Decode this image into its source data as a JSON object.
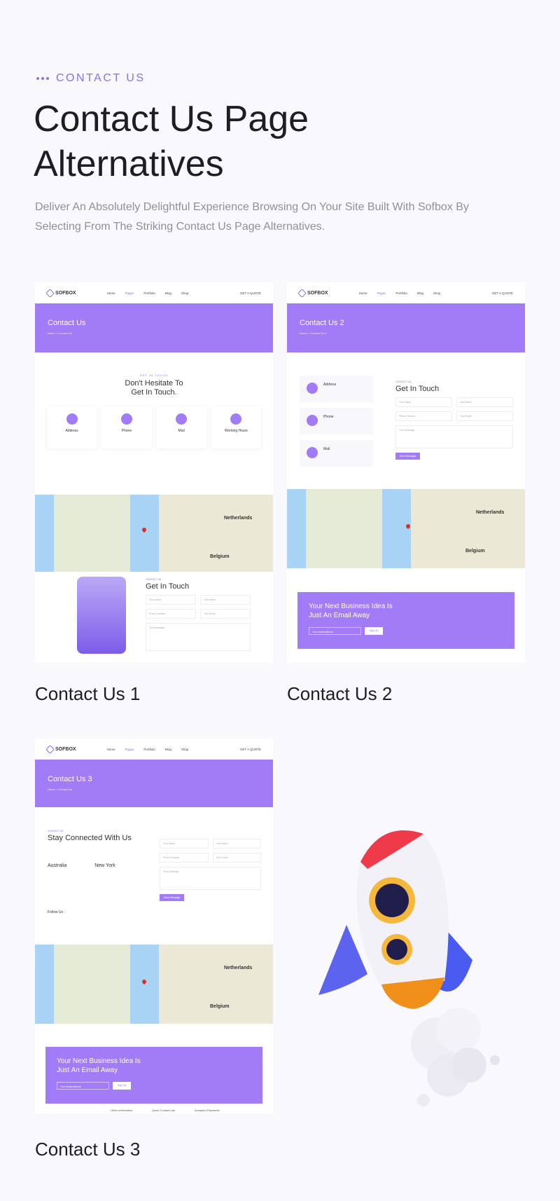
{
  "header": {
    "eyebrow": "CONTACT US",
    "title": "Contact Us Page Alternatives",
    "subtitle": "Deliver An Absolutely Delightful Experience Browsing On Your Site Built With Sofbox By Selecting From The Striking Contact Us Page Alternatives."
  },
  "nav": {
    "logo": "SOFBOX",
    "items": [
      "Home",
      "Pages",
      "Portfolio",
      "Blog",
      "Shop"
    ],
    "quote": "GET A QUOTE"
  },
  "map": {
    "labels": [
      "Netherlands",
      "Belgium"
    ]
  },
  "form": {
    "name": "Your Name",
    "last": "Last Name",
    "phone": "Phone Number",
    "email": "Your Email",
    "message": "Your Message",
    "send": "Send Message",
    "eyebrow": "CONTACT US",
    "title": "Get In Touch"
  },
  "cta": {
    "title": "Your Next Business Idea Is Just An Email Away",
    "email": "Your email address",
    "signup": "Sign Up"
  },
  "cards": [
    {
      "caption": "Contact Us 1",
      "banner": "Contact Us",
      "crumb": "Home  >  Contact Us",
      "eyebrow": "GET IN TOUCH",
      "heading": "Don't Hesitate To Get In Touch.",
      "infos": [
        "Address",
        "Phone",
        "Mail",
        "Working Hours"
      ]
    },
    {
      "caption": "Contact Us 2",
      "banner": "Contact Us 2",
      "crumb": "Home  >  Contact Us 2",
      "infos": [
        "Address",
        "Phone",
        "Mail"
      ]
    },
    {
      "caption": "Contact Us 3",
      "banner": "Contact Us 3",
      "crumb": "Home  >  Contact Us",
      "heading": "Stay Connected With Us",
      "cities": [
        "Australia",
        "New York"
      ],
      "follow": "Follow Us :",
      "footer": [
        "Other Information",
        "Quick Contact Info",
        "Accepted Payments"
      ]
    }
  ]
}
